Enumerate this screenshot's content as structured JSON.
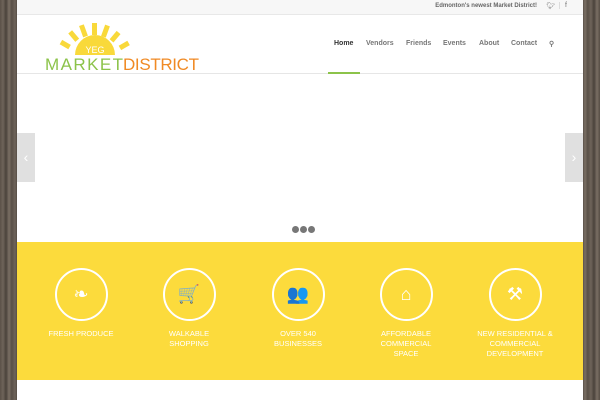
{
  "topbar": {
    "tagline": "Edmonton's newest Market District!",
    "social": [
      "twitter-icon",
      "facebook-icon"
    ]
  },
  "logo": {
    "yeg": "YEG",
    "market": "MARKET",
    "district": "DISTRICT"
  },
  "nav": [
    "Home",
    "Vendors",
    "Friends",
    "Events",
    "About",
    "Contact"
  ],
  "slider": {
    "prev": "‹",
    "next": "›",
    "slides": 3
  },
  "features": [
    {
      "icon": "leaf-icon",
      "glyph": "❧",
      "label": "FRESH PRODUCE"
    },
    {
      "icon": "cart-icon",
      "glyph": "🛒",
      "label": "WALKABLE SHOPPING"
    },
    {
      "icon": "users-icon",
      "glyph": "👥",
      "label": "OVER 540 BUSINESSES"
    },
    {
      "icon": "home-icon",
      "glyph": "⌂",
      "label": "AFFORDABLE COMMERCIAL SPACE"
    },
    {
      "icon": "tools-icon",
      "glyph": "⚒",
      "label": "NEW RESIDENTIAL & COMMERCIAL DEVELOPMENT"
    }
  ],
  "colors": {
    "yellow": "#fcdb3c",
    "green": "#8cc34a",
    "orange": "#f08a24"
  }
}
